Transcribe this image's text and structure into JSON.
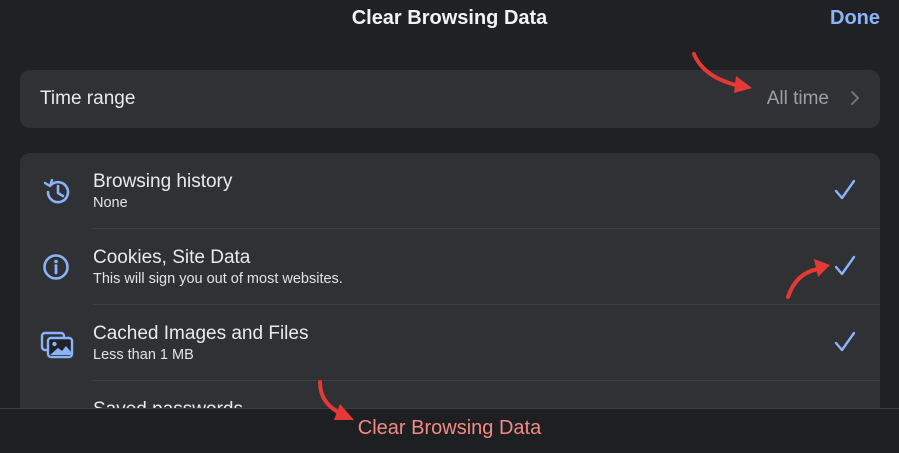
{
  "header": {
    "title": "Clear Browsing Data",
    "done_label": "Done"
  },
  "time_range": {
    "label": "Time range",
    "value": "All time"
  },
  "items": [
    {
      "title": "Browsing history",
      "subtitle": "None",
      "icon": "history-icon",
      "checked": true
    },
    {
      "title": "Cookies, Site Data",
      "subtitle": "This will sign you out of most websites.",
      "icon": "info-icon",
      "checked": true
    },
    {
      "title": "Cached Images and Files",
      "subtitle": "Less than 1 MB",
      "icon": "images-icon",
      "checked": true
    },
    {
      "title": "Saved passwords",
      "subtitle": "",
      "icon": "key-icon",
      "checked": false
    }
  ],
  "footer": {
    "clear_label": "Clear Browsing Data"
  },
  "colors": {
    "accent": "#8ab4f8",
    "destructive": "#f28b82",
    "annotation": "#e53935"
  }
}
